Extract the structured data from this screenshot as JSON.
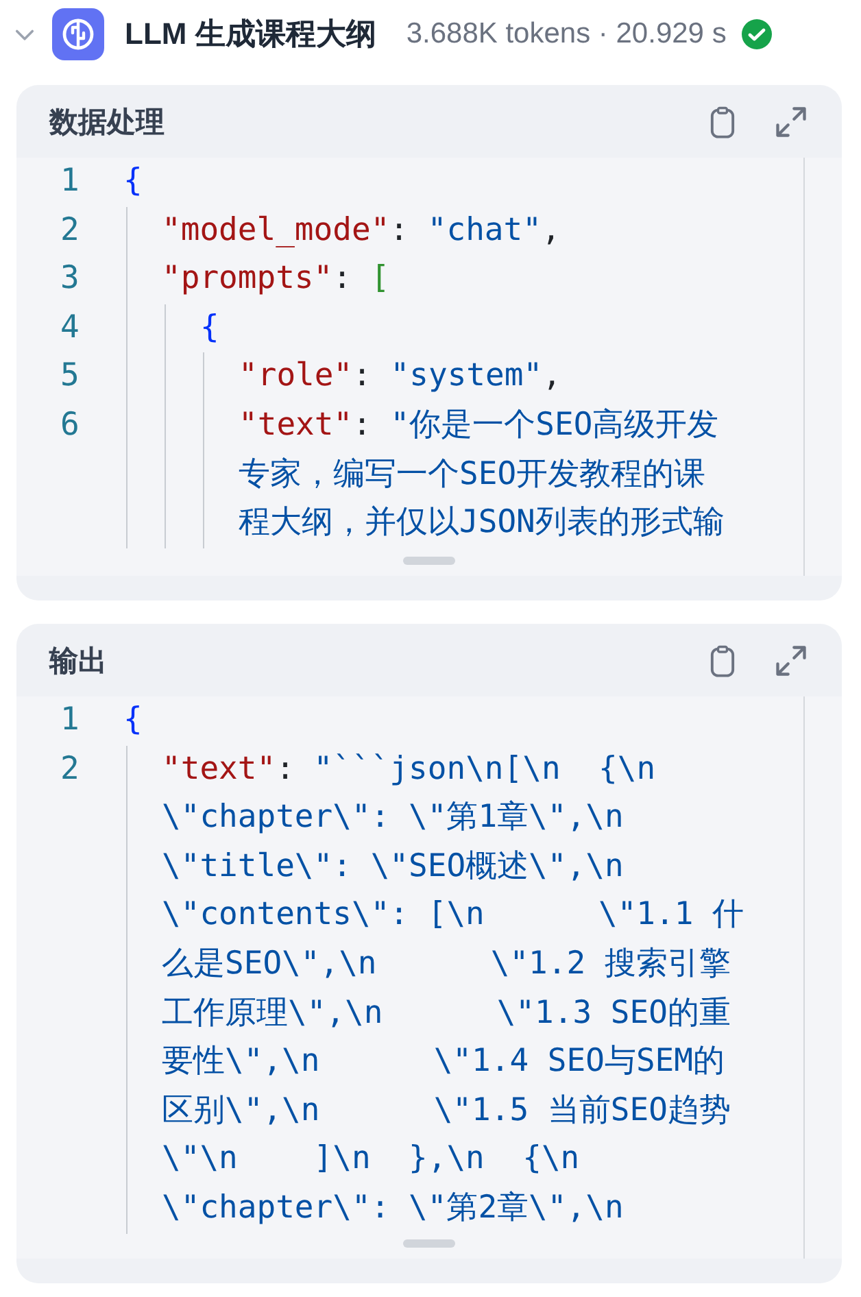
{
  "node": {
    "title": "LLM 生成课程大纲",
    "meta": "3.688K tokens · 20.929 s",
    "succeeded": true,
    "expanded": true
  },
  "panels": [
    {
      "title": "数据处理",
      "lines": [
        {
          "number": "1",
          "rows": [
            [
              {
                "kind": "brace",
                "text": "{"
              }
            ]
          ],
          "children": [
            {
              "number": "2",
              "rows": [
                [
                  {
                    "kind": "key",
                    "text": "\"model_mode\""
                  },
                  {
                    "kind": "punct",
                    "text": ": "
                  },
                  {
                    "kind": "string",
                    "text": "\"chat\""
                  },
                  {
                    "kind": "punct",
                    "text": ","
                  }
                ]
              ]
            },
            {
              "number": "3",
              "rows": [
                [
                  {
                    "kind": "key",
                    "text": "\"prompts\""
                  },
                  {
                    "kind": "punct",
                    "text": ": "
                  },
                  {
                    "kind": "bracket",
                    "text": "["
                  }
                ]
              ],
              "children": [
                {
                  "number": "4",
                  "rows": [
                    [
                      {
                        "kind": "brace",
                        "text": "{"
                      }
                    ]
                  ],
                  "children": [
                    {
                      "number": "5",
                      "rows": [
                        [
                          {
                            "kind": "key",
                            "text": "\"role\""
                          },
                          {
                            "kind": "punct",
                            "text": ": "
                          },
                          {
                            "kind": "string",
                            "text": "\"system\""
                          },
                          {
                            "kind": "punct",
                            "text": ","
                          }
                        ]
                      ]
                    },
                    {
                      "number": "6",
                      "rows": [
                        [
                          {
                            "kind": "key",
                            "text": "\"text\""
                          },
                          {
                            "kind": "punct",
                            "text": ": "
                          },
                          {
                            "kind": "string",
                            "text": "\"你是一个SEO高级开发"
                          }
                        ],
                        [
                          {
                            "kind": "string",
                            "text": "专家，编写一个SEO开发教程的课"
                          }
                        ],
                        [
                          {
                            "kind": "string",
                            "text": "程大纲，并仅以JSON列表的形式输"
                          }
                        ]
                      ]
                    }
                  ]
                }
              ]
            }
          ]
        }
      ]
    },
    {
      "title": "输出",
      "lines": [
        {
          "number": "1",
          "rows": [
            [
              {
                "kind": "brace",
                "text": "{"
              }
            ]
          ],
          "children": [
            {
              "number": "2",
              "rows": [
                [
                  {
                    "kind": "key",
                    "text": "\"text\""
                  },
                  {
                    "kind": "punct",
                    "text": ": "
                  },
                  {
                    "kind": "string",
                    "text": "\"```json\\n[\\n  {\\n"
                  }
                ],
                [
                  {
                    "kind": "string",
                    "text": "\\\"chapter\\\": \\\"第1章\\\",\\n"
                  }
                ],
                [
                  {
                    "kind": "string",
                    "text": "\\\"title\\\": \\\"SEO概述\\\",\\n"
                  }
                ],
                [
                  {
                    "kind": "string",
                    "text": "\\\"contents\\\": [\\n      \\\"1.1 什"
                  }
                ],
                [
                  {
                    "kind": "string",
                    "text": "么是SEO\\\",\\n      \\\"1.2 搜索引擎"
                  }
                ],
                [
                  {
                    "kind": "string",
                    "text": "工作原理\\\",\\n      \\\"1.3 SEO的重"
                  }
                ],
                [
                  {
                    "kind": "string",
                    "text": "要性\\\",\\n      \\\"1.4 SEO与SEM的"
                  }
                ],
                [
                  {
                    "kind": "string",
                    "text": "区别\\\",\\n      \\\"1.5 当前SEO趋势"
                  }
                ],
                [
                  {
                    "kind": "string",
                    "text": "\\\"\\n    ]\\n  },\\n  {\\n"
                  }
                ],
                [
                  {
                    "kind": "string",
                    "text": "\\\"chapter\\\": \\\"第2章\\\",\\n"
                  }
                ]
              ]
            }
          ]
        }
      ]
    }
  ]
}
